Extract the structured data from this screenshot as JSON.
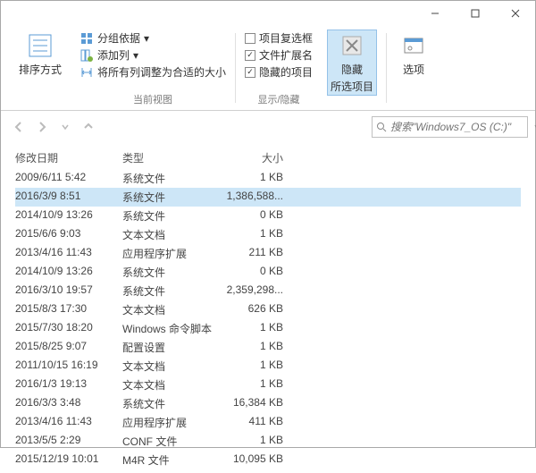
{
  "ribbon": {
    "sort_label": "排序方式",
    "group_by": "分组依据",
    "add_column": "添加列",
    "fit_all_columns": "将所有列调整为合适的大小",
    "item_checkboxes": "项目复选框",
    "file_ext": "文件扩展名",
    "hidden_items": "隐藏的项目",
    "hide_selected_line1": "隐藏",
    "hide_selected_line2": "所选项目",
    "options": "选项",
    "group1_label": "当前视图",
    "group2_label": "显示/隐藏"
  },
  "search": {
    "placeholder": "搜索\"Windows7_OS (C:)\""
  },
  "columns": {
    "date": "修改日期",
    "type": "类型",
    "size": "大小"
  },
  "rows": [
    {
      "date": "2009/6/11 5:42",
      "type": "系统文件",
      "size": "1 KB",
      "sel": false
    },
    {
      "date": "2016/3/9 8:51",
      "type": "系统文件",
      "size": "1,386,588...",
      "sel": true
    },
    {
      "date": "2014/10/9 13:26",
      "type": "系统文件",
      "size": "0 KB",
      "sel": false
    },
    {
      "date": "2015/6/6 9:03",
      "type": "文本文档",
      "size": "1 KB",
      "sel": false
    },
    {
      "date": "2013/4/16 11:43",
      "type": "应用程序扩展",
      "size": "211 KB",
      "sel": false
    },
    {
      "date": "2014/10/9 13:26",
      "type": "系统文件",
      "size": "0 KB",
      "sel": false
    },
    {
      "date": "2016/3/10 19:57",
      "type": "系统文件",
      "size": "2,359,298...",
      "sel": false
    },
    {
      "date": "2015/8/3 17:30",
      "type": "文本文档",
      "size": "626 KB",
      "sel": false
    },
    {
      "date": "2015/7/30 18:20",
      "type": "Windows 命令脚本",
      "size": "1 KB",
      "sel": false
    },
    {
      "date": "2015/8/25 9:07",
      "type": "配置设置",
      "size": "1 KB",
      "sel": false
    },
    {
      "date": "2011/10/15 16:19",
      "type": "文本文档",
      "size": "1 KB",
      "sel": false
    },
    {
      "date": "2016/1/3 19:13",
      "type": "文本文档",
      "size": "1 KB",
      "sel": false
    },
    {
      "date": "2016/3/3 3:48",
      "type": "系统文件",
      "size": "16,384 KB",
      "sel": false
    },
    {
      "date": "2013/4/16 11:43",
      "type": "应用程序扩展",
      "size": "411 KB",
      "sel": false
    },
    {
      "date": "2013/5/5 2:29",
      "type": "CONF 文件",
      "size": "1 KB",
      "sel": false
    },
    {
      "date": "2015/12/19 10:01",
      "type": "M4R 文件",
      "size": "10,095 KB",
      "sel": false
    }
  ]
}
